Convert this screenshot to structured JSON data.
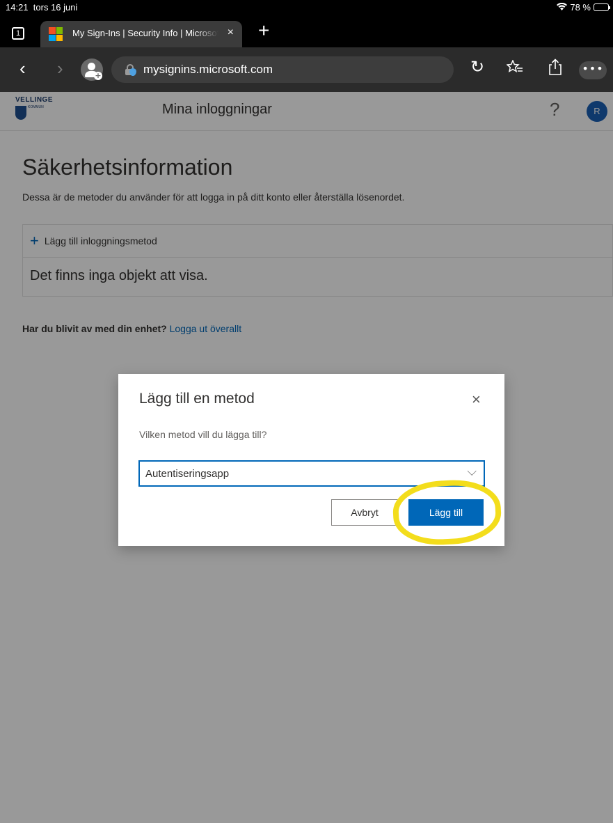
{
  "status_bar": {
    "time": "14:21",
    "date": "tors 16 juni",
    "battery_text": "78 %",
    "battery_level": 0.78
  },
  "browser": {
    "tab_count": "1",
    "tab_title": "My Sign-Ins | Security Info | Microsoft",
    "tab_close": "×",
    "new_tab": "+",
    "url": "mysignins.microsoft.com",
    "icons": [
      "back-icon",
      "forward-icon",
      "profile-icon",
      "lock-icon",
      "reload-icon",
      "favorites-icon",
      "share-icon",
      "more-icon"
    ]
  },
  "site": {
    "org_name": "VELLINGE",
    "org_sub": "KOMMUN",
    "title": "Mina inloggningar",
    "help": "?",
    "avatar_initial": "R"
  },
  "main": {
    "title": "Säkerhetsinformation",
    "description": "Dessa är de metoder du använder för att logga in på ditt konto eller återställa lösenordet.",
    "add_method_label": "Lägg till inloggningsmetod",
    "empty_text": "Det finns inga objekt att visa.",
    "lost_device_question": "Har du blivit av med din enhet?",
    "lost_device_link": "Logga ut överallt"
  },
  "dialog": {
    "title": "Lägg till en metod",
    "close": "×",
    "question": "Vilken metod vill du lägga till?",
    "selected_method": "Autentiseringsapp",
    "cancel_label": "Avbryt",
    "add_label": "Lägg till"
  },
  "colors": {
    "accent": "#0067b8",
    "highlight": "#f3dd1c"
  }
}
